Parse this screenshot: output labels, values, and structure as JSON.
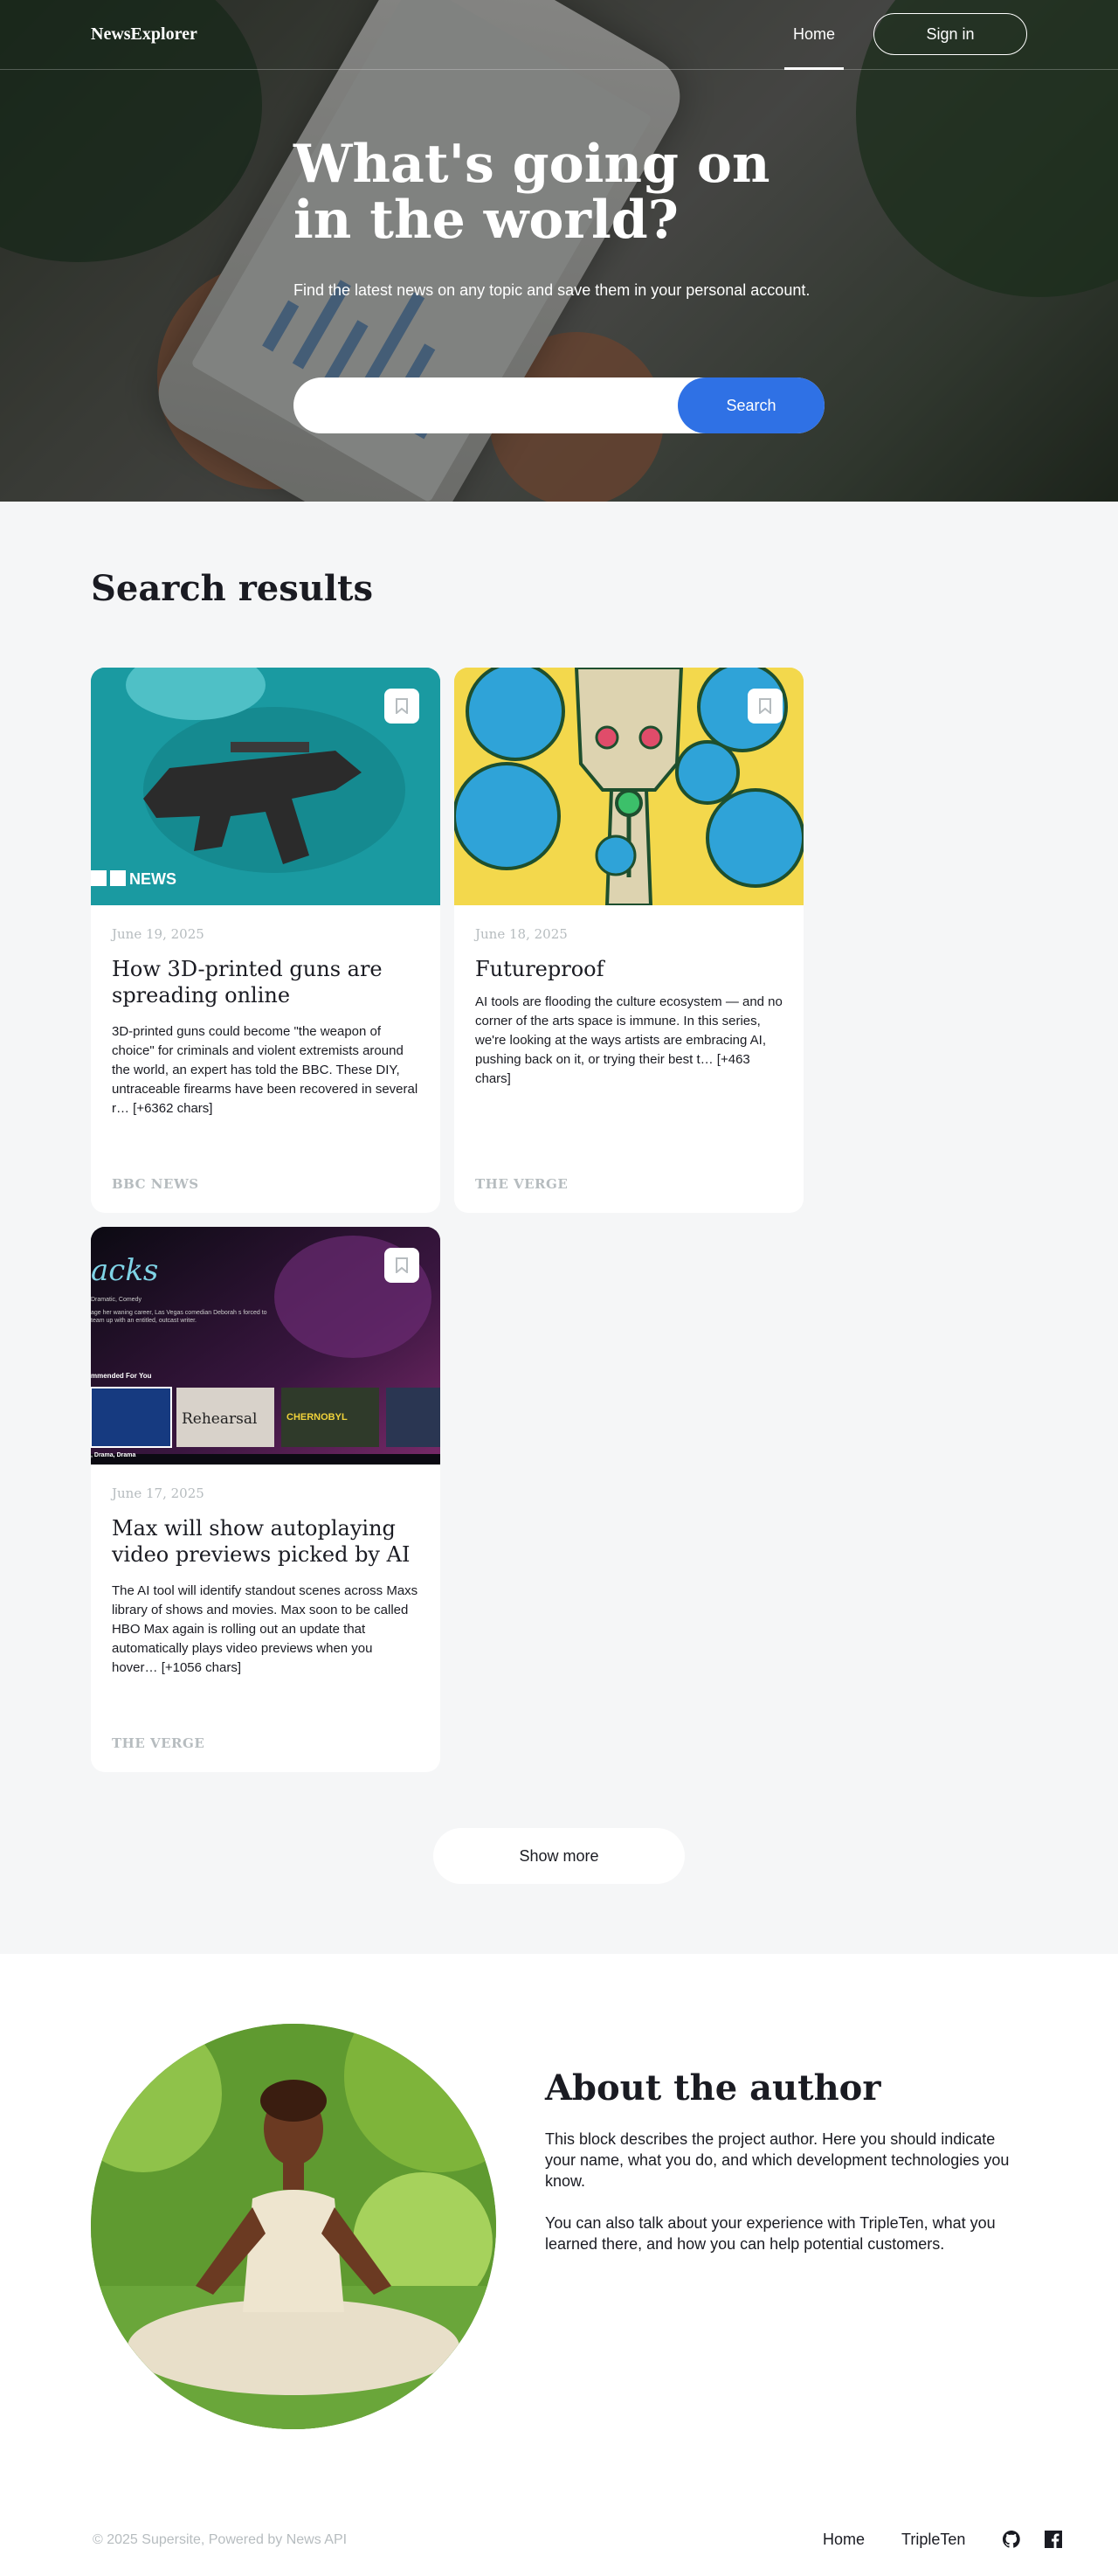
{
  "header": {
    "logo": "NewsExplorer",
    "nav_home": "Home",
    "nav_signin": "Sign in"
  },
  "hero": {
    "title": "What's going on in the world?",
    "subtitle": "Find the latest news on any topic and save them in your personal account.",
    "search_placeholder": "",
    "search_button": "Search"
  },
  "results": {
    "title": "Search results",
    "show_more": "Show more",
    "cards": [
      {
        "date": "June 19, 2025",
        "title": "How 3D-printed guns are spreading online",
        "text": "3D-printed guns could become \"the weapon of choice\" for criminals and violent extremists around the world, an expert has told the BBC. These DIY, untraceable firearms have been recovered in several r… [+6362 chars]",
        "source": "BBC News",
        "image_label": "NEWS",
        "image_icon": "bbc-logo"
      },
      {
        "date": "June 18, 2025",
        "title": "Futureproof",
        "text": "AI tools are flooding the culture ecosystem — and no corner of the arts space is immune. In this series, we're looking at the ways artists are embracing AI, pushing back on it, or trying their best t… [+463 chars]",
        "source": "The Verge"
      },
      {
        "date": "June 17, 2025",
        "title": "Max will show autoplaying video previews picked by AI",
        "text": "The AI tool will identify standout scenes across Maxs library of shows and movies. Max soon to be called HBO Max again is rolling out an update that automatically plays video previews when you hover… [+1056 chars]",
        "source": "The Verge",
        "image_texts": {
          "show_title": "acks",
          "genre": "Dramatic, Comedy",
          "desc": "age her waning career, Las Vegas comedian Deborah s forced to team up with an entitled, outcast writer.",
          "row_label": "mmended For You",
          "tile_2": "Rehearsal",
          "tile_3": "CHERNOBYL",
          "footer": ", Drama, Drama"
        }
      }
    ]
  },
  "about": {
    "title": "About the author",
    "p1": "This block describes the project author. Here you should indicate your name, what you do, and which development technologies you know.",
    "p2": "You can also talk about your experience with TripleTen, what you learned there, and how you can help potential customers."
  },
  "footer": {
    "copyright": "© 2025 Supersite, Powered by News API",
    "link_home": "Home",
    "link_tripleten": "TripleTen",
    "icons": [
      "github-icon",
      "facebook-icon"
    ]
  },
  "colors": {
    "accent": "#2f71e5",
    "muted": "#b6bcbf",
    "text": "#1a1b22",
    "section_bg": "#f5f6f7"
  }
}
